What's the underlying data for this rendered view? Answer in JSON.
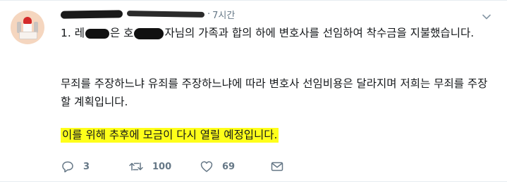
{
  "header": {
    "separator": "·",
    "time": "7시간"
  },
  "tweet": {
    "para1_prefix": "1. 레",
    "para1_mid": "은 호",
    "para1_suffix": "자님의 가족과 합의 하에 변호사를 선임하여 착수금을 지불했습니다.",
    "para2": "무죄를 주장하느냐 유죄를 주장하느냐에 따라 변호사 선임비용은 달라지며 저희는 무죄를 주장할 계획입니다.",
    "para3": "이를 위해 추후에 모금이 다시 열릴 예정입니다."
  },
  "actions": {
    "reply_icon": "reply-icon",
    "reply_count": "3",
    "retweet_icon": "retweet-icon",
    "retweet_count": "100",
    "like_icon": "heart-icon",
    "like_count": "69",
    "dm_icon": "envelope-icon"
  },
  "colors": {
    "highlight": "#ffff1a",
    "muted": "#657786",
    "text": "#14171a"
  }
}
